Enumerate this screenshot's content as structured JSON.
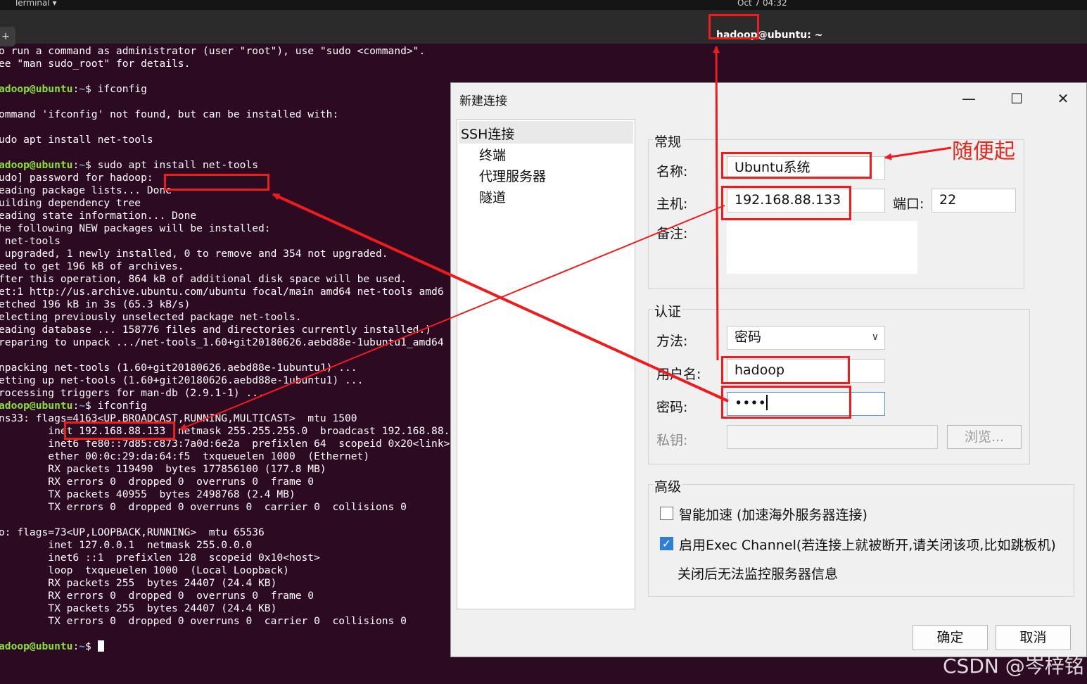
{
  "system": {
    "app_menu": "Terminal ▾",
    "clock": "Oct 7  04:32"
  },
  "terminal": {
    "title": "hadoop@ubuntu: ~",
    "new_tab_icon": "+",
    "lines": [
      {
        "text": "o run a command as administrator (user \"root\"), use \"sudo <command>\"."
      },
      {
        "text": "ee \"man sudo_root\" for details."
      },
      {
        "text": ""
      },
      {
        "prompt": "adoop@ubuntu",
        "path": "~",
        "cmd": "$ ifconfig"
      },
      {
        "text": ""
      },
      {
        "text": "ommand 'ifconfig' not found, but can be installed with:"
      },
      {
        "text": ""
      },
      {
        "text": "udo apt install net-tools"
      },
      {
        "text": ""
      },
      {
        "prompt": "adoop@ubuntu",
        "path": "~",
        "cmd": "$ sudo apt install net-tools"
      },
      {
        "text": "udo] password for hadoop:"
      },
      {
        "text": "eading package lists... Done"
      },
      {
        "text": "uilding dependency tree"
      },
      {
        "text": "eading state information... Done"
      },
      {
        "text": "he following NEW packages will be installed:"
      },
      {
        "text": " net-tools"
      },
      {
        "text": " upgraded, 1 newly installed, 0 to remove and 354 not upgraded."
      },
      {
        "text": "eed to get 196 kB of archives."
      },
      {
        "text": "fter this operation, 864 kB of additional disk space will be used."
      },
      {
        "text": "et:1 http://us.archive.ubuntu.com/ubuntu focal/main amd64 net-tools amd6"
      },
      {
        "text": "etched 196 kB in 3s (65.3 kB/s)"
      },
      {
        "text": "electing previously unselected package net-tools."
      },
      {
        "text": "eading database ... 158776 files and directories currently installed.)"
      },
      {
        "text": "reparing to unpack .../net-tools_1.60+git20180626.aebd88e-1ubuntu1_amd64"
      },
      {
        "text": ""
      },
      {
        "text": "npacking net-tools (1.60+git20180626.aebd88e-1ubuntu1) ..."
      },
      {
        "text": "etting up net-tools (1.60+git20180626.aebd88e-1ubuntu1) ..."
      },
      {
        "text": "rocessing triggers for man-db (2.9.1-1) ..."
      },
      {
        "prompt": "adoop@ubuntu",
        "path": "~",
        "cmd": "$ ifconfig"
      },
      {
        "text": "ns33: flags=4163<UP,BROADCAST,RUNNING,MULTICAST>  mtu 1500"
      },
      {
        "text": "        inet 192.168.88.133  netmask 255.255.255.0  broadcast 192.168.88."
      },
      {
        "text": "        inet6 fe80::7d85:c873:7a0d:6e2a  prefixlen 64  scopeid 0x20<link>"
      },
      {
        "text": "        ether 00:0c:29:da:64:f5  txqueuelen 1000  (Ethernet)"
      },
      {
        "text": "        RX packets 119490  bytes 177856100 (177.8 MB)"
      },
      {
        "text": "        RX errors 0  dropped 0  overruns 0  frame 0"
      },
      {
        "text": "        TX packets 40955  bytes 2498768 (2.4 MB)"
      },
      {
        "text": "        TX errors 0  dropped 0 overruns 0  carrier 0  collisions 0"
      },
      {
        "text": ""
      },
      {
        "text": "o: flags=73<UP,LOOPBACK,RUNNING>  mtu 65536"
      },
      {
        "text": "        inet 127.0.0.1  netmask 255.0.0.0"
      },
      {
        "text": "        inet6 ::1  prefixlen 128  scopeid 0x10<host>"
      },
      {
        "text": "        loop  txqueuelen 1000  (Local Loopback)"
      },
      {
        "text": "        RX packets 255  bytes 24407 (24.4 KB)"
      },
      {
        "text": "        RX errors 0  dropped 0  overruns 0  frame 0"
      },
      {
        "text": "        TX packets 255  bytes 24407 (24.4 KB)"
      },
      {
        "text": "        TX errors 0  dropped 0 overruns 0  carrier 0  collisions 0"
      },
      {
        "text": ""
      },
      {
        "prompt": "adoop@ubuntu",
        "path": "~",
        "cmd": "$ ",
        "cursor": true
      }
    ]
  },
  "dialog": {
    "title": "新建连接",
    "minimize_icon": "—",
    "maximize_icon": "☐",
    "close_icon": "✕",
    "tree": {
      "root": "SSH连接",
      "children": [
        "终端",
        "代理服务器",
        "隧道"
      ]
    },
    "general": {
      "title": "常规",
      "name_label": "名称:",
      "name_value": "Ubuntu系统",
      "host_label": "主机:",
      "host_value": "192.168.88.133",
      "port_label": "端口:",
      "port_value": "22",
      "note_label": "备注:",
      "note_value": ""
    },
    "auth": {
      "title": "认证",
      "method_label": "方法:",
      "method_value": "密码",
      "method_chevron": "∨",
      "user_label": "用户名:",
      "user_value": "hadoop",
      "pass_label": "密码:",
      "pass_value": "••••",
      "key_label": "私钥:",
      "key_value": "",
      "browse_label": "浏览..."
    },
    "advanced": {
      "title": "高级",
      "opt1_label": "智能加速 (加速海外服务器连接)",
      "opt1_checked": false,
      "opt2_label": "启用Exec Channel(若连接上就被断开,请关闭该项,比如跳板机)",
      "opt2_checked": true,
      "opt2_mark": "✓",
      "opt2_note": "关闭后无法监控服务器信息"
    },
    "ok_label": "确定",
    "cancel_label": "取消"
  },
  "annotation": {
    "note": "随便起",
    "color": "#ee1c1c"
  },
  "watermark": "CSDN @岑梓铭"
}
